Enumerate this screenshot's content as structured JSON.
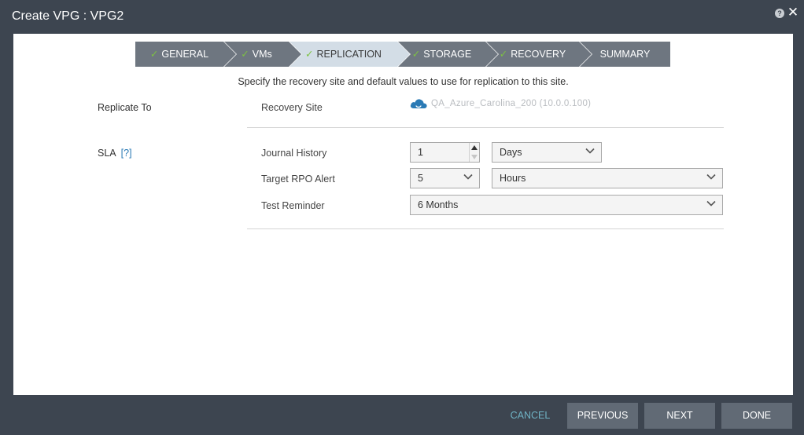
{
  "window": {
    "title": "Create VPG : VPG2",
    "help_icon_glyph": "?",
    "close_icon_glyph": "✕"
  },
  "wizard": {
    "steps": [
      {
        "label": "GENERAL",
        "completed": true,
        "active": false
      },
      {
        "label": "VMs",
        "completed": true,
        "active": false
      },
      {
        "label": "REPLICATION",
        "completed": true,
        "active": true
      },
      {
        "label": "STORAGE",
        "completed": true,
        "active": false
      },
      {
        "label": "RECOVERY",
        "completed": true,
        "active": false
      },
      {
        "label": "SUMMARY",
        "completed": false,
        "active": false
      }
    ],
    "check_glyph": "✓"
  },
  "main": {
    "subtitle": "Specify the recovery site and default values to use for replication to this site.",
    "replicate_to": {
      "section_label": "Replicate To",
      "recovery_site_label": "Recovery Site",
      "recovery_site_value": "QA_Azure_Carolina_200 (10.0.0.100)",
      "site_icon": "cloud-icon"
    },
    "sla": {
      "section_label": "SLA",
      "help_link": "[?]",
      "journal_history": {
        "label": "Journal History",
        "value": "1",
        "unit": "Days"
      },
      "target_rpo_alert": {
        "label": "Target RPO Alert",
        "value": "5",
        "unit": "Hours"
      },
      "test_reminder": {
        "label": "Test Reminder",
        "value": "6 Months"
      }
    }
  },
  "footer": {
    "cancel": "CANCEL",
    "previous": "PREVIOUS",
    "next": "NEXT",
    "done": "DONE"
  },
  "colors": {
    "window_bg": "#3d4550",
    "step_bg": "#6e7680",
    "step_active_bg": "#d3dde6",
    "check_green": "#7dc242",
    "cancel_link": "#6fb3c5",
    "button_bg": "#616a75",
    "cloud_blue": "#2a7ab5"
  }
}
